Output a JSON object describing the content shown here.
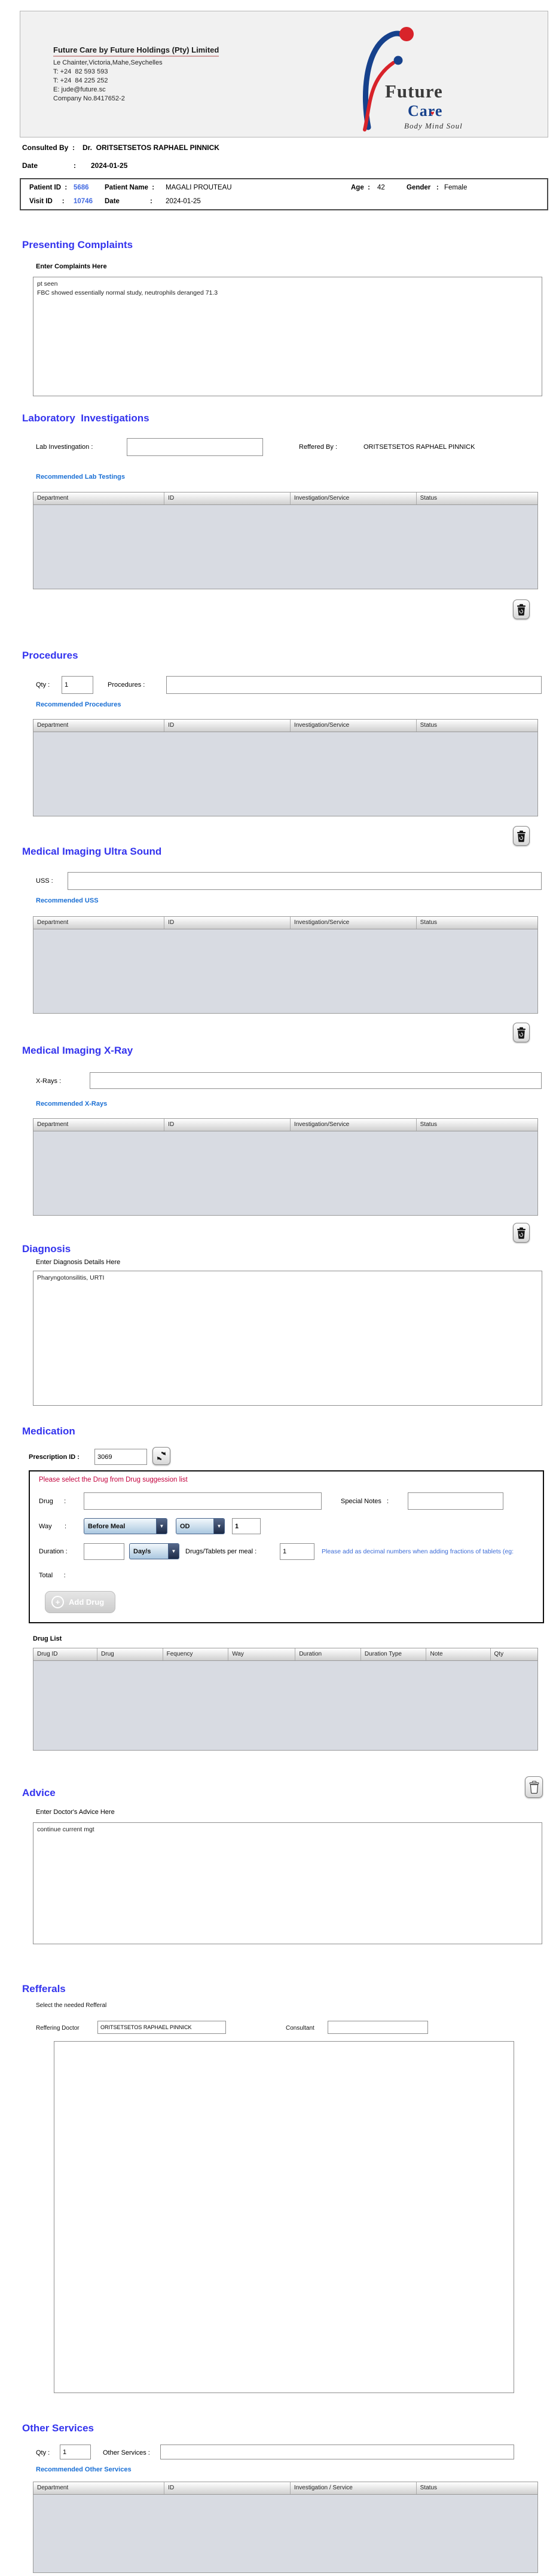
{
  "icons": {
    "dropdown_arrow": "▼",
    "heart": "♥",
    "plus": "+"
  },
  "colors": {
    "heading_blue": "#3333ee",
    "link_blue": "#1a6fd4",
    "id_blue": "#4169e1",
    "warning_red": "#c2003c",
    "note_blue": "#3b6bd6",
    "logo_blue": "#16418c",
    "logo_red": "#d8232a",
    "table_body_gray": "#d8dbe2"
  },
  "header": {
    "company_name": "Future Care by Future Holdings (Pty) Limited",
    "address": "Le Chainter,Victoria,Mahe,Seychelles",
    "phone1": "T: +24  82 593 593",
    "phone2": "T: +24  84 225 252",
    "email": "E: jude@future.sc",
    "company_no": "Company No.8417652-2",
    "logo": {
      "word1": "Future",
      "word2": "Care",
      "tagline": "Body Mind Soul"
    }
  },
  "consultation": {
    "consulted_by_label": "Consulted By  :",
    "consulted_by": "Dr.  ORITSETSETOS RAPHAEL PINNICK",
    "date_label": "Date                  :",
    "date": "2024-01-25"
  },
  "patient": {
    "patient_id_label": "Patient ID  :",
    "patient_id": "5686",
    "patient_name_label": "Patient Name  :",
    "patient_name": "MAGALI PROUTEAU",
    "age_label": "Age  :",
    "age": "42",
    "gender_label": "Gender   :",
    "gender": "Female",
    "visit_id_label": "Visit ID     :",
    "visit_id": "10746",
    "date_label": "Date                :",
    "date": "2024-01-25"
  },
  "complaints": {
    "title": "Presenting Complaints",
    "label": "Enter Complaints Here",
    "text": "pt seen\nFBC showed essentially normal study, neutrophils deranged 71.3"
  },
  "lab": {
    "title": "Laboratory  Investigations",
    "field_label": "Lab Investingation :",
    "field_value": "",
    "referred_by_label": "Reffered By :",
    "referred_by": "ORITSETSETOS RAPHAEL PINNICK",
    "link": "Recommended Lab Testings",
    "table_headers": [
      "Department",
      "ID",
      "Investigation/Service",
      "Status"
    ],
    "rows": []
  },
  "procedures": {
    "title": "Procedures",
    "qty_label": "Qty :",
    "qty_value": "1",
    "field_label": "Procedures :",
    "field_value": "",
    "link": "Recommended Procedures",
    "table_headers": [
      "Department",
      "ID",
      "Investigation/Service",
      "Status"
    ],
    "rows": []
  },
  "uss": {
    "title": "Medical Imaging Ultra Sound",
    "field_label": "USS :",
    "field_value": "",
    "link": "Recommended USS",
    "table_headers": [
      "Department",
      "ID",
      "Investigation/Service",
      "Status"
    ],
    "rows": []
  },
  "xray": {
    "title": "Medical Imaging X-Ray",
    "field_label": "X-Rays :",
    "field_value": "",
    "link": "Recommended X-Rays",
    "table_headers": [
      "Department",
      "ID",
      "Investigation/Service",
      "Status"
    ],
    "rows": []
  },
  "diagnosis": {
    "title": "Diagnosis",
    "label": "Enter Diagnosis Details Here",
    "text": "Pharyngotonsilitis, URTI"
  },
  "medication": {
    "title": "Medication",
    "prescription_id_label": "Prescription ID :",
    "prescription_id": "3069",
    "warning": "Please select the Drug from Drug suggession list",
    "drug_label": "Drug      :",
    "drug_value": "",
    "special_notes_label": "Special Notes   :",
    "special_notes_value": "",
    "way_label": "Way       :",
    "meal_select": "Before Meal",
    "frequency_select": "OD",
    "way_qty": "1",
    "duration_label": "Duration :",
    "duration_value": "",
    "duration_unit_select": "Day/s",
    "per_meal_label": "Drugs/Tablets per meal :",
    "per_meal_value": "1",
    "note": "Please add as decimal numbers when adding fractions of tablets (eg:",
    "total_label": "Total      :",
    "add_drug_label": "Add Drug",
    "drug_list_label": "Drug List",
    "table_headers": [
      "Drug ID",
      "Drug",
      "Fequency",
      "Way",
      "Duration",
      "Duration Type",
      "Note",
      "Qty"
    ],
    "rows": []
  },
  "advice": {
    "title": "Advice",
    "label": "Enter Doctor's Advice Here",
    "text": "continue current mgt"
  },
  "referrals": {
    "title": "Refferals",
    "subtitle": "Select the needed Refferal",
    "doctor_label": "Reffering Doctor",
    "doctor_value": "ORITSETSETOS RAPHAEL PINNICK",
    "consultant_label": "Consultant",
    "consultant_value": ""
  },
  "other_services": {
    "title": "Other Services",
    "qty_label": "Qty :",
    "qty_value": "1",
    "field_label": "Other Services :",
    "field_value": "",
    "link": "Recommended Other Services",
    "table_headers": [
      "Department",
      "ID",
      "Investigation / Service",
      "Status"
    ],
    "rows": []
  }
}
